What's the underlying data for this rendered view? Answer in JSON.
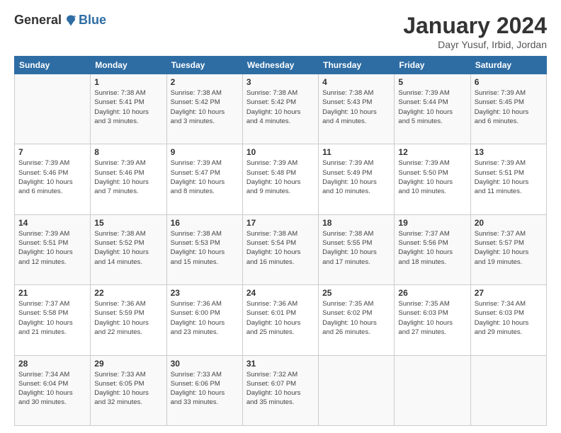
{
  "header": {
    "logo_general": "General",
    "logo_blue": "Blue",
    "month": "January 2024",
    "location": "Dayr Yusuf, Irbid, Jordan"
  },
  "days_of_week": [
    "Sunday",
    "Monday",
    "Tuesday",
    "Wednesday",
    "Thursday",
    "Friday",
    "Saturday"
  ],
  "weeks": [
    [
      {
        "day": "",
        "info": ""
      },
      {
        "day": "1",
        "info": "Sunrise: 7:38 AM\nSunset: 5:41 PM\nDaylight: 10 hours\nand 3 minutes."
      },
      {
        "day": "2",
        "info": "Sunrise: 7:38 AM\nSunset: 5:42 PM\nDaylight: 10 hours\nand 3 minutes."
      },
      {
        "day": "3",
        "info": "Sunrise: 7:38 AM\nSunset: 5:42 PM\nDaylight: 10 hours\nand 4 minutes."
      },
      {
        "day": "4",
        "info": "Sunrise: 7:38 AM\nSunset: 5:43 PM\nDaylight: 10 hours\nand 4 minutes."
      },
      {
        "day": "5",
        "info": "Sunrise: 7:39 AM\nSunset: 5:44 PM\nDaylight: 10 hours\nand 5 minutes."
      },
      {
        "day": "6",
        "info": "Sunrise: 7:39 AM\nSunset: 5:45 PM\nDaylight: 10 hours\nand 6 minutes."
      }
    ],
    [
      {
        "day": "7",
        "info": "Sunrise: 7:39 AM\nSunset: 5:46 PM\nDaylight: 10 hours\nand 6 minutes."
      },
      {
        "day": "8",
        "info": "Sunrise: 7:39 AM\nSunset: 5:46 PM\nDaylight: 10 hours\nand 7 minutes."
      },
      {
        "day": "9",
        "info": "Sunrise: 7:39 AM\nSunset: 5:47 PM\nDaylight: 10 hours\nand 8 minutes."
      },
      {
        "day": "10",
        "info": "Sunrise: 7:39 AM\nSunset: 5:48 PM\nDaylight: 10 hours\nand 9 minutes."
      },
      {
        "day": "11",
        "info": "Sunrise: 7:39 AM\nSunset: 5:49 PM\nDaylight: 10 hours\nand 10 minutes."
      },
      {
        "day": "12",
        "info": "Sunrise: 7:39 AM\nSunset: 5:50 PM\nDaylight: 10 hours\nand 10 minutes."
      },
      {
        "day": "13",
        "info": "Sunrise: 7:39 AM\nSunset: 5:51 PM\nDaylight: 10 hours\nand 11 minutes."
      }
    ],
    [
      {
        "day": "14",
        "info": "Sunrise: 7:39 AM\nSunset: 5:51 PM\nDaylight: 10 hours\nand 12 minutes."
      },
      {
        "day": "15",
        "info": "Sunrise: 7:38 AM\nSunset: 5:52 PM\nDaylight: 10 hours\nand 14 minutes."
      },
      {
        "day": "16",
        "info": "Sunrise: 7:38 AM\nSunset: 5:53 PM\nDaylight: 10 hours\nand 15 minutes."
      },
      {
        "day": "17",
        "info": "Sunrise: 7:38 AM\nSunset: 5:54 PM\nDaylight: 10 hours\nand 16 minutes."
      },
      {
        "day": "18",
        "info": "Sunrise: 7:38 AM\nSunset: 5:55 PM\nDaylight: 10 hours\nand 17 minutes."
      },
      {
        "day": "19",
        "info": "Sunrise: 7:37 AM\nSunset: 5:56 PM\nDaylight: 10 hours\nand 18 minutes."
      },
      {
        "day": "20",
        "info": "Sunrise: 7:37 AM\nSunset: 5:57 PM\nDaylight: 10 hours\nand 19 minutes."
      }
    ],
    [
      {
        "day": "21",
        "info": "Sunrise: 7:37 AM\nSunset: 5:58 PM\nDaylight: 10 hours\nand 21 minutes."
      },
      {
        "day": "22",
        "info": "Sunrise: 7:36 AM\nSunset: 5:59 PM\nDaylight: 10 hours\nand 22 minutes."
      },
      {
        "day": "23",
        "info": "Sunrise: 7:36 AM\nSunset: 6:00 PM\nDaylight: 10 hours\nand 23 minutes."
      },
      {
        "day": "24",
        "info": "Sunrise: 7:36 AM\nSunset: 6:01 PM\nDaylight: 10 hours\nand 25 minutes."
      },
      {
        "day": "25",
        "info": "Sunrise: 7:35 AM\nSunset: 6:02 PM\nDaylight: 10 hours\nand 26 minutes."
      },
      {
        "day": "26",
        "info": "Sunrise: 7:35 AM\nSunset: 6:03 PM\nDaylight: 10 hours\nand 27 minutes."
      },
      {
        "day": "27",
        "info": "Sunrise: 7:34 AM\nSunset: 6:03 PM\nDaylight: 10 hours\nand 29 minutes."
      }
    ],
    [
      {
        "day": "28",
        "info": "Sunrise: 7:34 AM\nSunset: 6:04 PM\nDaylight: 10 hours\nand 30 minutes."
      },
      {
        "day": "29",
        "info": "Sunrise: 7:33 AM\nSunset: 6:05 PM\nDaylight: 10 hours\nand 32 minutes."
      },
      {
        "day": "30",
        "info": "Sunrise: 7:33 AM\nSunset: 6:06 PM\nDaylight: 10 hours\nand 33 minutes."
      },
      {
        "day": "31",
        "info": "Sunrise: 7:32 AM\nSunset: 6:07 PM\nDaylight: 10 hours\nand 35 minutes."
      },
      {
        "day": "",
        "info": ""
      },
      {
        "day": "",
        "info": ""
      },
      {
        "day": "",
        "info": ""
      }
    ]
  ]
}
